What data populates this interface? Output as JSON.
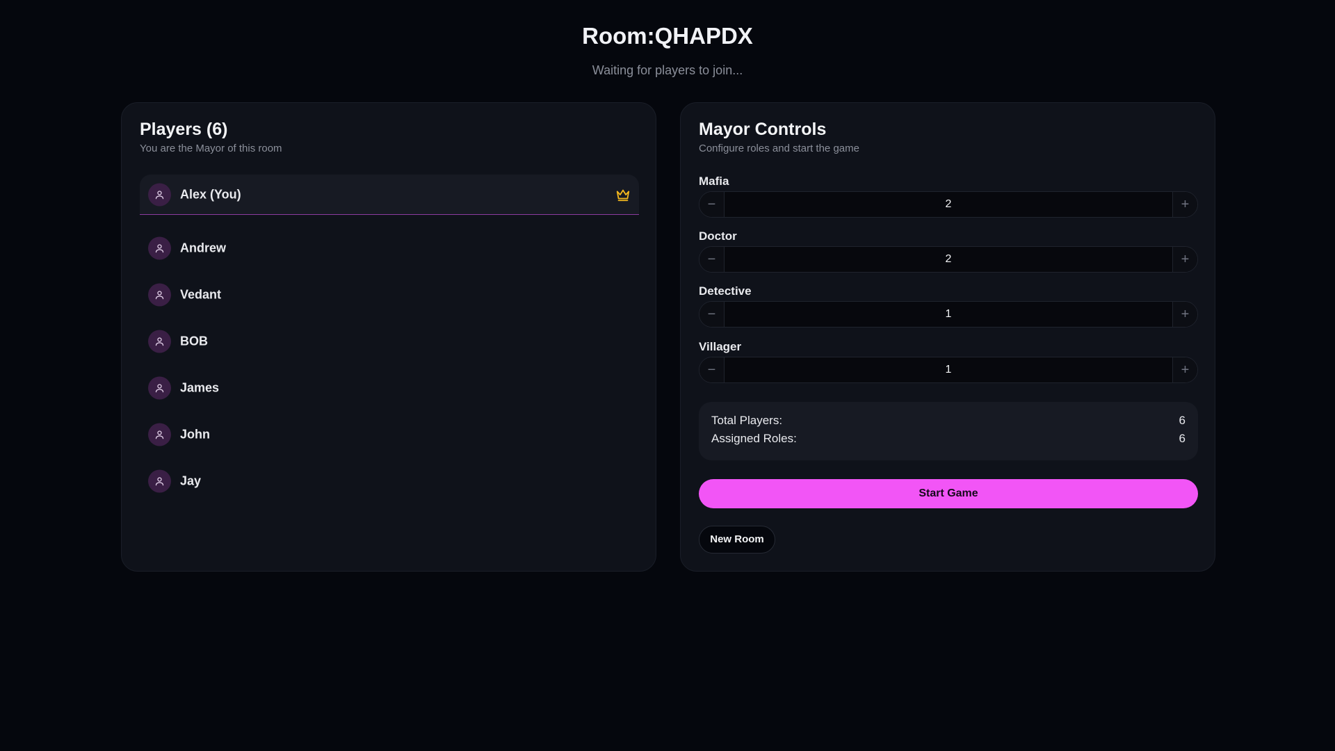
{
  "header": {
    "title": "Room:QHAPDX",
    "subtitle": "Waiting for players to join..."
  },
  "players_panel": {
    "title": "Players (6)",
    "description": "You are the Mayor of this room",
    "mayor": {
      "name": "Alex (You)",
      "icon": "crown-icon",
      "icon_color": "#f5b91e"
    },
    "players": [
      {
        "name": "Andrew"
      },
      {
        "name": "Vedant"
      },
      {
        "name": "BOB"
      },
      {
        "name": "James"
      },
      {
        "name": "John"
      },
      {
        "name": "Jay"
      }
    ]
  },
  "controls_panel": {
    "title": "Mayor Controls",
    "description": "Configure roles and start the game",
    "roles": [
      {
        "label": "Mafia",
        "value": "2"
      },
      {
        "label": "Doctor",
        "value": "2"
      },
      {
        "label": "Detective",
        "value": "1"
      },
      {
        "label": "Villager",
        "value": "1"
      }
    ],
    "minus_symbol": "−",
    "plus_symbol": "+",
    "summary": {
      "total_label": "Total Players:",
      "total_value": "6",
      "assigned_label": "Assigned Roles:",
      "assigned_value": "6"
    },
    "start_button": "Start Game",
    "new_room_button": "New Room"
  },
  "colors": {
    "background": "#05070d",
    "panel": "#0f121a",
    "accent": "#f255f6",
    "avatar": "#3a1f45",
    "crown": "#f5b91e"
  }
}
